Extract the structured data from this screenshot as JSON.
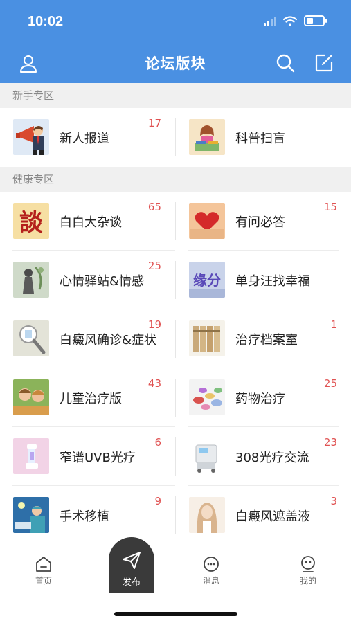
{
  "status": {
    "time": "10:02"
  },
  "nav": {
    "title": "论坛版块"
  },
  "sections": [
    {
      "title": "新手专区"
    },
    {
      "title": "健康专区"
    }
  ],
  "forums": {
    "newbie": [
      {
        "name": "新人报道",
        "count": "17",
        "thumb": "megaphone-man-image"
      },
      {
        "name": "科普扫盲",
        "count": "",
        "thumb": "reading-girl-image"
      }
    ],
    "health": [
      {
        "name": "白白大杂谈",
        "count": "65",
        "thumb": "calligraphy-character-image"
      },
      {
        "name": "有问必答",
        "count": "15",
        "thumb": "heart-hands-image"
      },
      {
        "name": "心情驿站&情感",
        "count": "25",
        "thumb": "sketch-figure-image"
      },
      {
        "name": "单身汪找幸福",
        "count": "",
        "thumb": "yuanfen-text-image"
      },
      {
        "name": "白癜风确诊&症状",
        "count": "19",
        "thumb": "uv-lamp-image"
      },
      {
        "name": "治疗档案室",
        "count": "1",
        "thumb": "archive-binders-image"
      },
      {
        "name": "儿童治疗版",
        "count": "43",
        "thumb": "children-image"
      },
      {
        "name": "药物治疗",
        "count": "25",
        "thumb": "pills-image"
      },
      {
        "name": "窄谱UVB光疗",
        "count": "6",
        "thumb": "uvb-device-image"
      },
      {
        "name": "308光疗交流",
        "count": "23",
        "thumb": "laser-machine-image"
      },
      {
        "name": "手术移植",
        "count": "9",
        "thumb": "surgery-image"
      },
      {
        "name": "白癜风遮盖液",
        "count": "3",
        "thumb": "woman-portrait-image"
      }
    ]
  },
  "tabs": [
    {
      "label": "首页",
      "icon": "home-icon"
    },
    {
      "label": "发布",
      "icon": "send-icon"
    },
    {
      "label": "消息",
      "icon": "message-icon"
    },
    {
      "label": "我的",
      "icon": "profile-icon"
    }
  ],
  "colors": {
    "accent": "#4a90e2",
    "count": "#e05252",
    "publish_bg": "#3a3a3a"
  }
}
